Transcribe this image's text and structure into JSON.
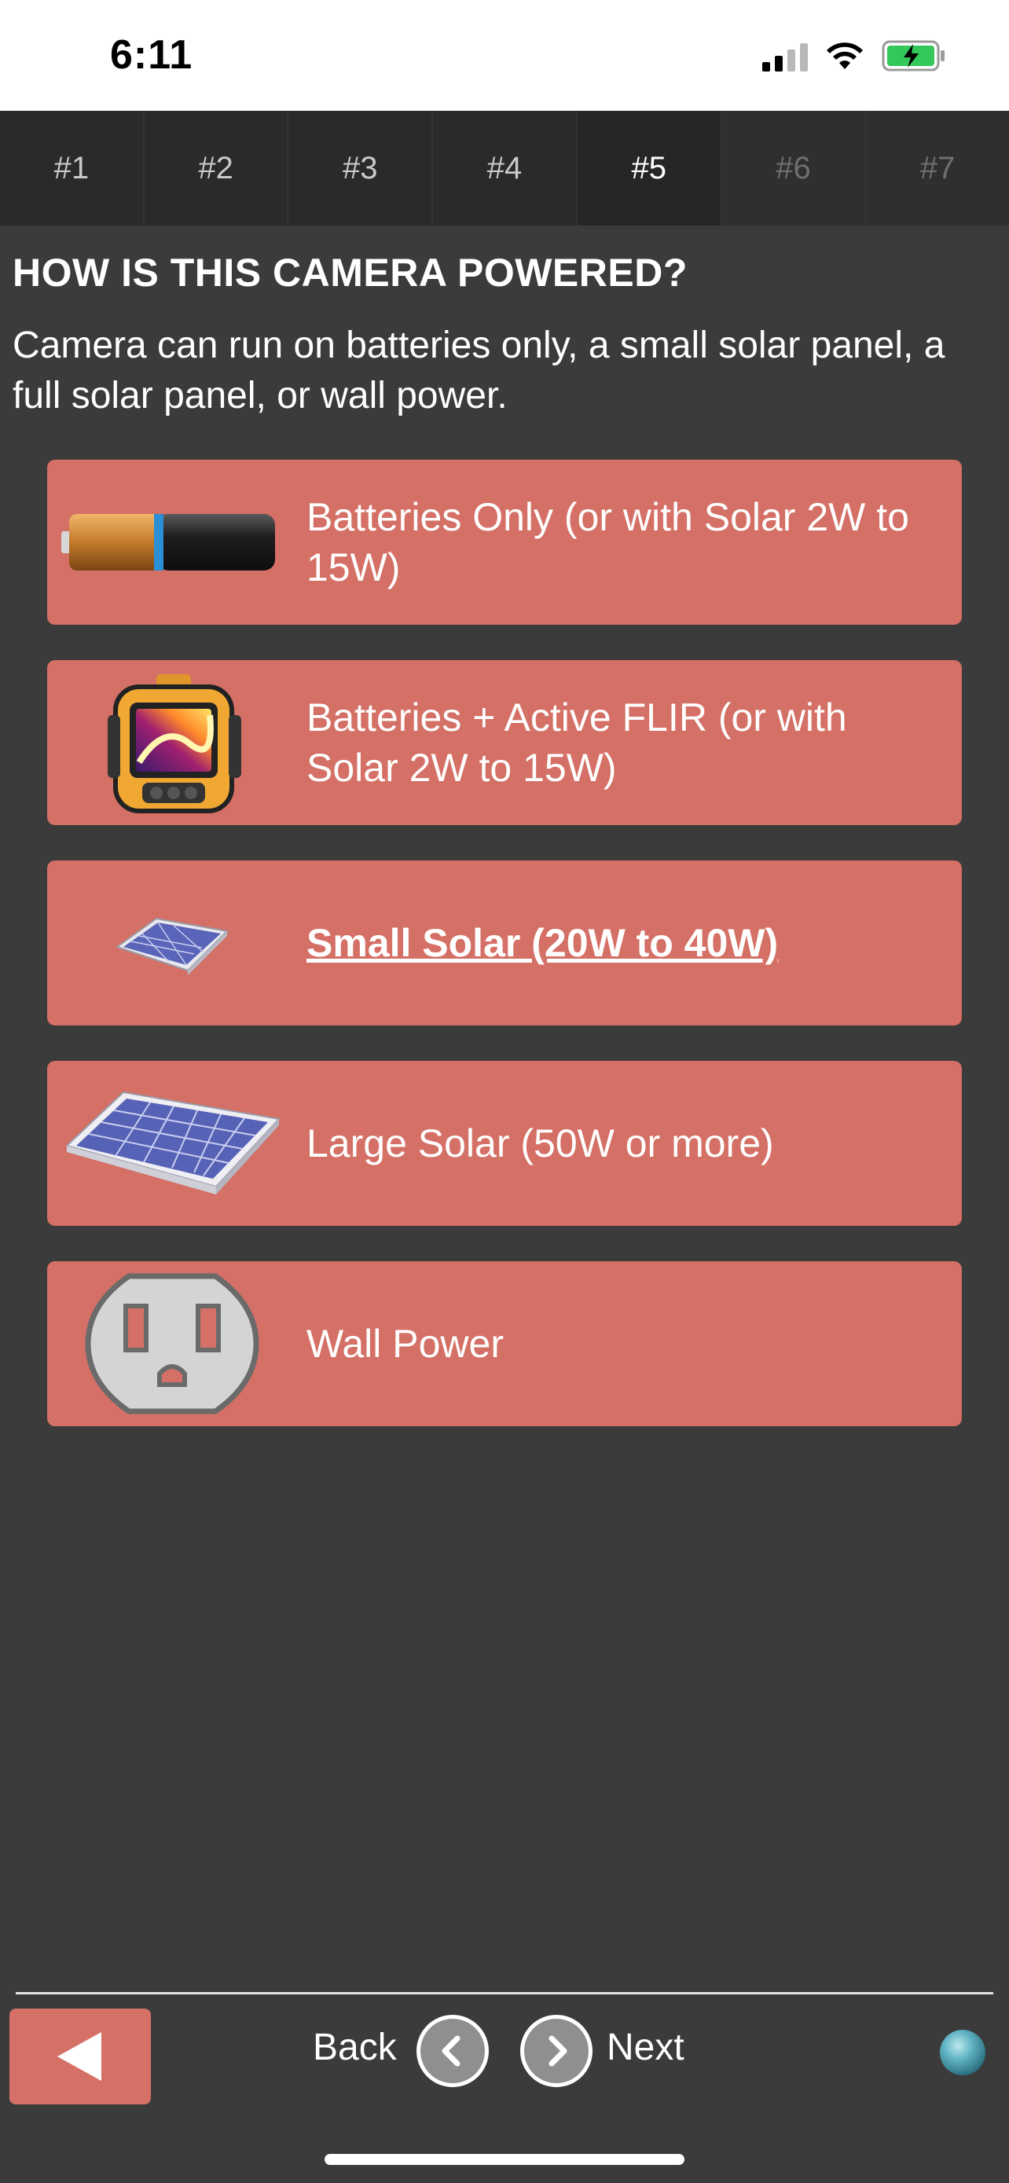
{
  "status_bar": {
    "time": "6:11"
  },
  "tabs": [
    {
      "label": "#1",
      "state": "normal"
    },
    {
      "label": "#2",
      "state": "normal"
    },
    {
      "label": "#3",
      "state": "normal"
    },
    {
      "label": "#4",
      "state": "normal"
    },
    {
      "label": "#5",
      "state": "active"
    },
    {
      "label": "#6",
      "state": "disabled"
    },
    {
      "label": "#7",
      "state": "disabled"
    }
  ],
  "question": {
    "title": "HOW IS THIS CAMERA POWERED?",
    "description": "Camera can run on batteries only, a small solar panel, a full solar panel, or wall power."
  },
  "options": [
    {
      "label": "Batteries Only (or with Solar 2W to 15W)",
      "icon": "battery-icon",
      "selected": false
    },
    {
      "label": "Batteries + Active FLIR (or with Solar 2W to 15W)",
      "icon": "thermal-camera-icon",
      "selected": false
    },
    {
      "label": "Small Solar (20W to 40W)",
      "icon": "small-solar-panel-icon",
      "selected": true
    },
    {
      "label": "Large Solar (50W or more)",
      "icon": "large-solar-panel-icon",
      "selected": false
    },
    {
      "label": "Wall Power",
      "icon": "wall-outlet-icon",
      "selected": false
    }
  ],
  "footer": {
    "back_label": "Back",
    "next_label": "Next"
  },
  "colors": {
    "background": "#3b3b3b",
    "option": "#d47066",
    "tabs": "#2a2a2a"
  }
}
